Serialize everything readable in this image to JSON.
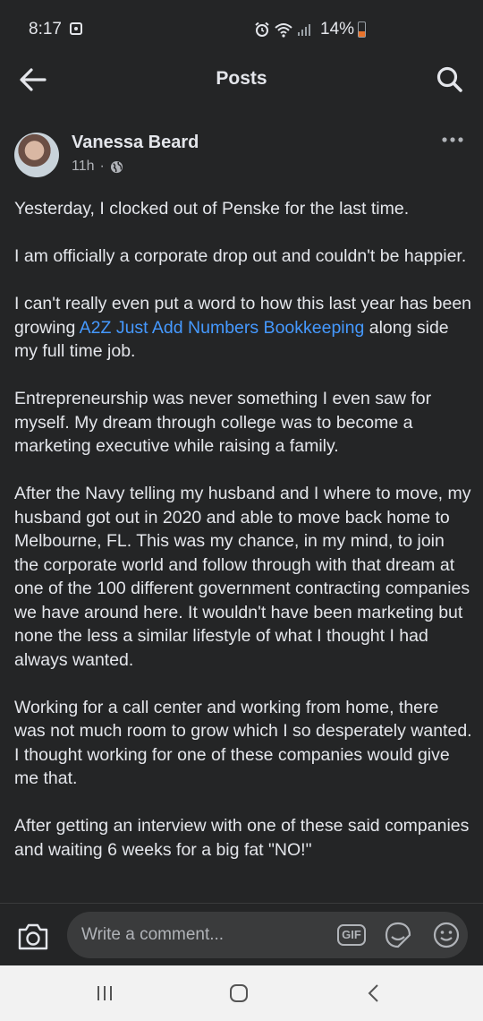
{
  "status_bar": {
    "time": "8:17",
    "battery": "14%"
  },
  "header": {
    "title": "Posts"
  },
  "post": {
    "author": "Vanessa Beard",
    "time_ago": "11h",
    "separator": "·",
    "paragraphs": [
      {
        "text": "Yesterday, I clocked out of Penske for the last time."
      },
      {
        "text": "I am officially a corporate drop out and couldn't be happier."
      },
      {
        "before": "I can't really even put a word to how this last year has been growing ",
        "link": "A2Z Just Add Numbers Bookkeeping",
        "after": " along side my full time job."
      },
      {
        "text": "Entrepreneurship was never something I even saw for myself. My dream through college was to become a marketing executive while raising a family."
      },
      {
        "text": "After the Navy telling my husband and I where to move, my husband got out in 2020 and able to move back home to Melbourne, FL. This was my chance, in my mind, to join the corporate world and follow through with that dream at one of the 100 different government contracting companies we have around here. It wouldn't have been marketing but none the less a similar lifestyle of what I thought I had always wanted."
      },
      {
        "text": "Working for a call center and working from home, there was not much room to grow which I so desperately wanted. I thought working for one of these companies would give me that."
      },
      {
        "text": "After getting an interview with one of these said companies and waiting 6 weeks for a big fat \"NO!\""
      }
    ]
  },
  "comment_bar": {
    "placeholder": "Write a comment...",
    "gif_label": "GIF"
  },
  "icons": {
    "back": "arrow-left-icon",
    "search": "search-icon",
    "more": "more-horizontal-icon",
    "privacy": "globe-icon",
    "camera": "camera-icon",
    "sticker": "sticker-icon",
    "emoji": "emoji-icon"
  },
  "colors": {
    "background": "#242526",
    "text": "#e4e6eb",
    "secondary_text": "#b0b3b8",
    "link": "#4599ff",
    "input_bg": "#3a3b3c",
    "battery_low": "#e8732b"
  }
}
